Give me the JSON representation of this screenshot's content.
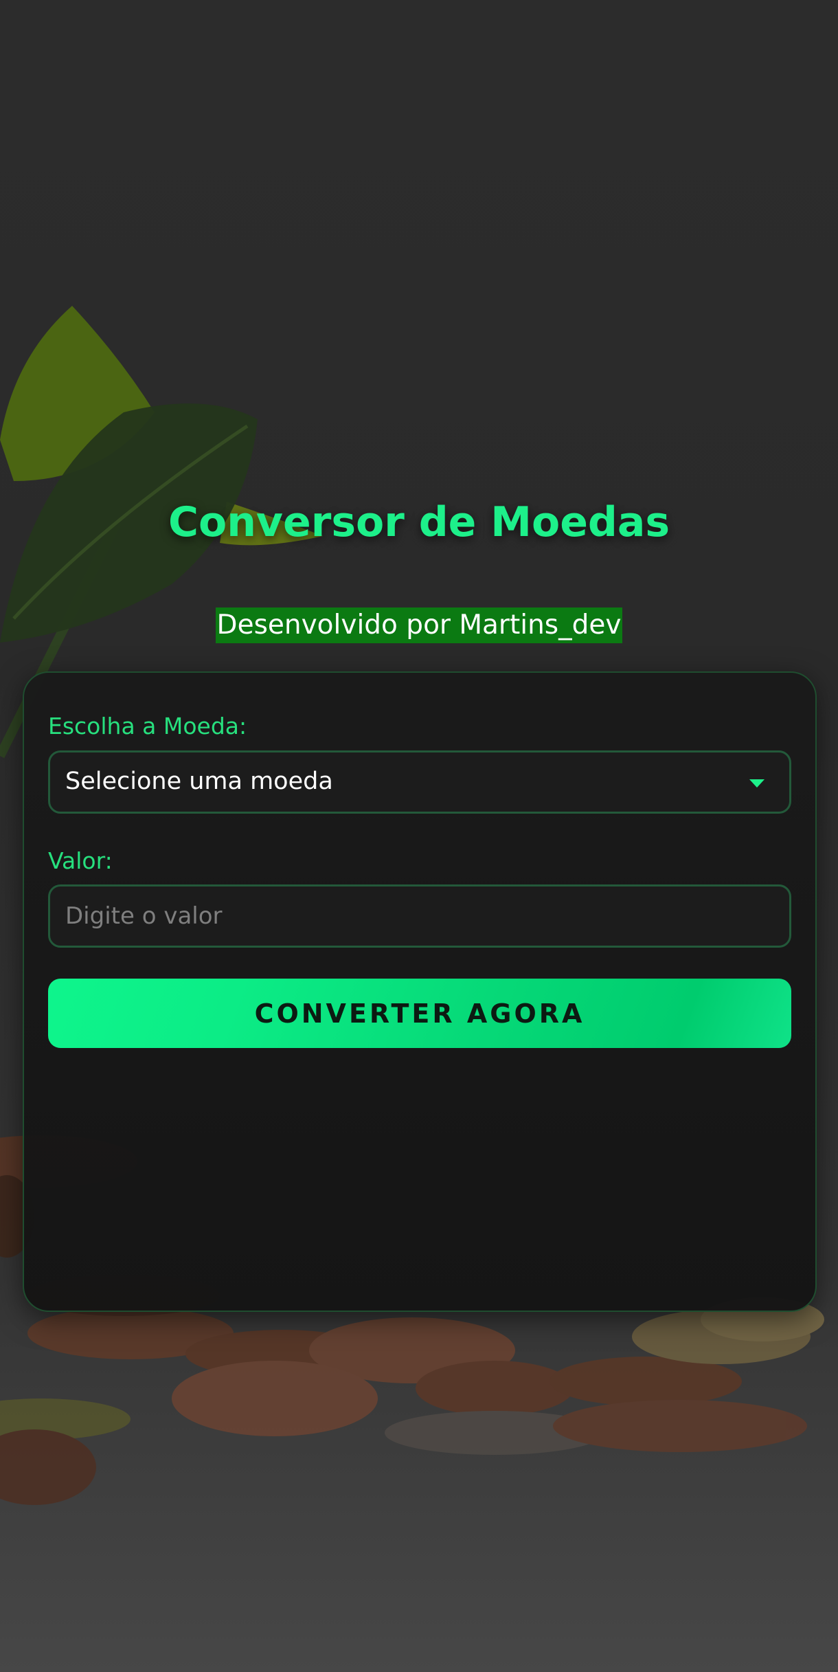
{
  "page": {
    "title": "Conversor de Moedas",
    "credit": "Desenvolvido por Martins_dev"
  },
  "form": {
    "currency_label": "Escolha a Moeda:",
    "currency_selected": "Selecione uma moeda",
    "value_label": "Valor:",
    "value_placeholder": "Digite o valor",
    "value_current": "",
    "submit_label": "CONVERTER AGORA"
  },
  "colors": {
    "accent": "#1df08a",
    "credit_bg": "#0b7a12",
    "card_bg": "#181818",
    "page_bg": "#2c2c2c"
  },
  "icons": {
    "select_caret": "caret-down-icon"
  }
}
